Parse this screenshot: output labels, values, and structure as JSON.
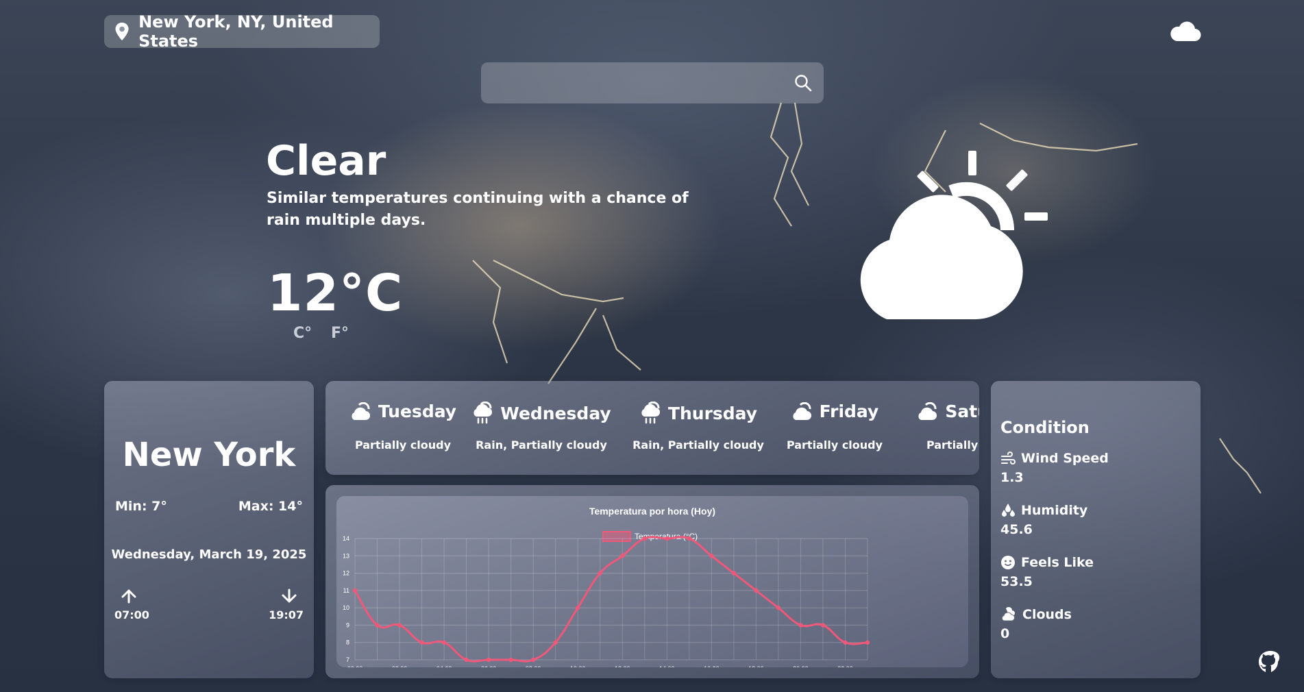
{
  "location": {
    "label": "New York, NY, United States"
  },
  "search": {
    "value": "",
    "placeholder": ""
  },
  "current": {
    "condition": "Clear",
    "description": "Similar temperatures continuing with a chance of rain multiple days.",
    "temperature": "12°C",
    "unit_c": "C°",
    "unit_f": "F°"
  },
  "city_card": {
    "city": "New York",
    "min": "Min: 7°",
    "max": "Max: 14°",
    "date": "Wednesday, March 19, 2025",
    "sunrise": "07:00",
    "sunset": "19:07"
  },
  "forecast": [
    {
      "day": "Tuesday",
      "desc": "Partially cloudy",
      "icon": "partly-cloudy-icon"
    },
    {
      "day": "Wednesday",
      "desc": "Rain, Partially cloudy",
      "icon": "rain-icon"
    },
    {
      "day": "Thursday",
      "desc": "Rain, Partially cloudy",
      "icon": "rain-icon"
    },
    {
      "day": "Friday",
      "desc": "Partially cloudy",
      "icon": "partly-cloudy-icon"
    },
    {
      "day": "Saturday",
      "desc": "Partially cloudy",
      "icon": "partly-cloudy-icon"
    }
  ],
  "conditions": {
    "title": "Condition",
    "wind_label": "Wind Speed",
    "wind_value": "1.3",
    "humidity_label": "Humidity",
    "humidity_value": "45.6",
    "feels_label": "Feels Like",
    "feels_value": "53.5",
    "clouds_label": "Clouds",
    "clouds_value": "0"
  },
  "colors": {
    "accent": "#f0587a",
    "text": "#ffffff"
  },
  "chart_data": {
    "type": "line",
    "title": "Temperatura por hora (Hoy)",
    "series": [
      {
        "name": "Temperatura (°C)",
        "values": [
          11,
          9,
          9,
          8,
          8,
          7,
          7,
          7,
          7,
          8,
          10,
          12,
          13,
          14,
          14,
          14,
          13,
          12,
          11,
          10,
          9,
          9,
          8,
          8
        ]
      }
    ],
    "x": [
      "00:00",
      "01:00",
      "02:00",
      "03:00",
      "04:00",
      "05:00",
      "06:00",
      "07:00",
      "08:00",
      "09:00",
      "10:00",
      "11:00",
      "12:00",
      "13:00",
      "14:00",
      "15:00",
      "16:00",
      "17:00",
      "18:00",
      "19:00",
      "20:00",
      "21:00",
      "22:00",
      "23:00"
    ],
    "x_tick_labels": [
      "00:00",
      "02:00",
      "04:00",
      "06:00",
      "08:00",
      "10:00",
      "12:00",
      "14:00",
      "16:00",
      "18:00",
      "20:00",
      "22:00"
    ],
    "y_ticks": [
      7,
      8,
      9,
      10,
      11,
      12,
      13,
      14
    ],
    "ylim": [
      7,
      14
    ],
    "grid": true,
    "legend": "top"
  }
}
